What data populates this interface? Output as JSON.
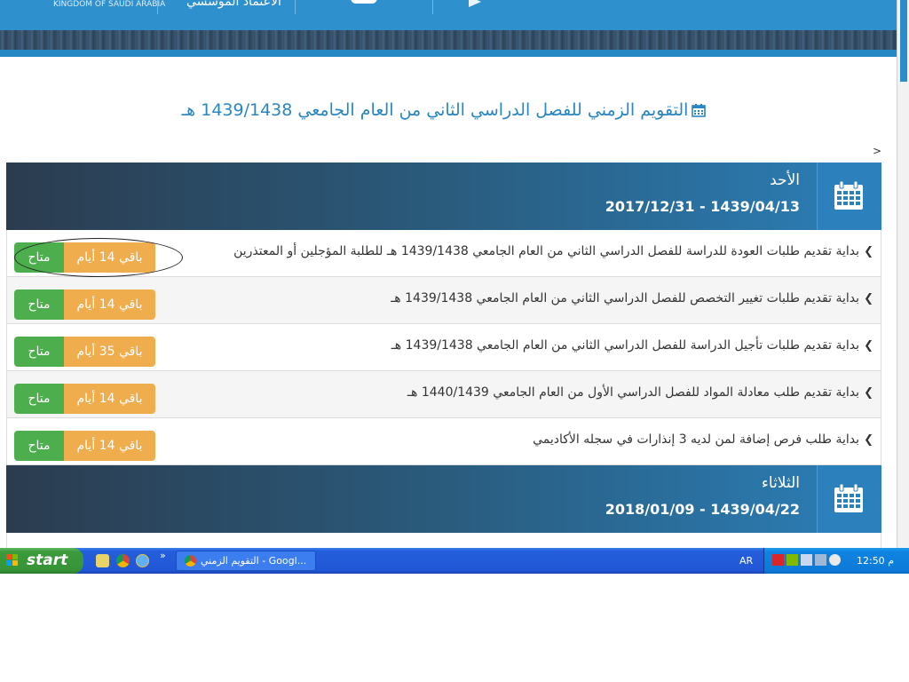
{
  "header": {
    "logo_small_text": "KINGDOM OF SAUDI ARABIA",
    "logo_arabic_text": "الاعتماد الموسسي"
  },
  "page": {
    "title": "التقويم الزمني للفصل الدراسي الثاني من العام الجامعي 1439/1438 هـ",
    "gt_mark": ">"
  },
  "days": [
    {
      "name": "الأحد",
      "date": "2017/12/31 - 1439/04/13",
      "items": [
        {
          "text": "بداية تقديم طلبات العودة للدراسة للفصل الدراسي الثاني من العام الجامعي 1439/1438 هـ للطلبة المؤجلين أو المعتذرين",
          "remaining": "باقي 14 أيام",
          "status": "متاح"
        },
        {
          "text": "بداية تقديم طلبات تغيير التخصص للفصل الدراسي الثاني من العام الجامعي 1439/1438 هـ",
          "remaining": "باقي 14 أيام",
          "status": "متاح"
        },
        {
          "text": "بداية تقديم طلبات تأجيل الدراسة للفصل الدراسي الثاني من العام الجامعي 1439/1438 هـ",
          "remaining": "باقي 35 أيام",
          "status": "متاح"
        },
        {
          "text": "بداية تقديم طلب معادلة المواد للفصل الدراسي الأول من العام الجامعي 1440/1439 هـ",
          "remaining": "باقي 14 أيام",
          "status": "متاح"
        },
        {
          "text": "بداية طلب فرص إضافة لمن لديه 3 إنذارات في سجله الأكاديمي",
          "remaining": "باقي 14 أيام",
          "status": "متاح"
        }
      ]
    },
    {
      "name": "الثلاثاء",
      "date": "2018/01/09 - 1439/04/22",
      "items": []
    }
  ],
  "taskbar": {
    "start_label": "start",
    "quicklaunch_chevron": "»",
    "task_label": "التقويم الزمني - Googl...",
    "language": "AR",
    "time": "12:50 م"
  },
  "colors": {
    "header_blue": "#2a8cc9",
    "title_blue": "#2a86c0",
    "status_green": "#4cae4c",
    "remaining_orange": "#efad4d",
    "taskbar_blue": "#245edb"
  },
  "icons": {
    "page_title": "calendar-icon",
    "day": "calendar-icon",
    "item": "chevron-left-icon"
  }
}
